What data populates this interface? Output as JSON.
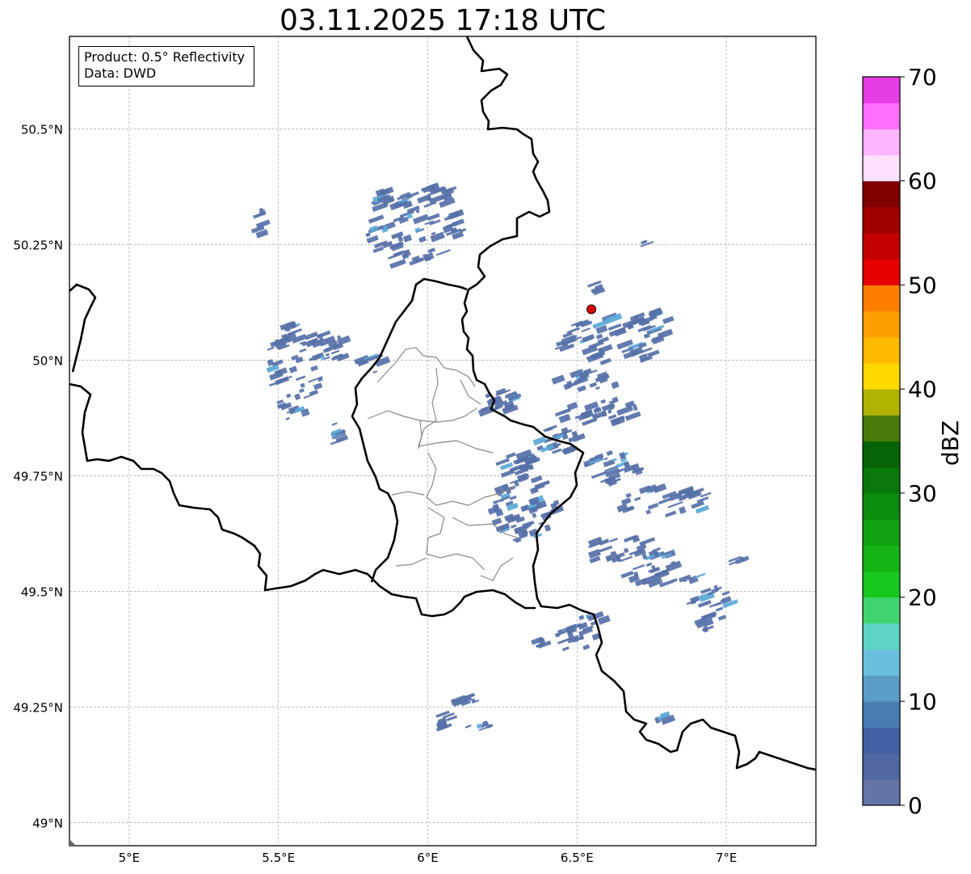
{
  "title": "03.11.2025 17:18 UTC",
  "info": {
    "product": "Product: 0.5° Reflectivity",
    "data": "Data: DWD"
  },
  "map_extent": {
    "lon": [
      4.8,
      7.3
    ],
    "lat": [
      48.95,
      50.7
    ]
  },
  "lat_ticks": [
    {
      "value": 50.5,
      "label": "50.5°N"
    },
    {
      "value": 50.25,
      "label": "50.25°N"
    },
    {
      "value": 50.0,
      "label": "50°N"
    },
    {
      "value": 49.75,
      "label": "49.75°N"
    },
    {
      "value": 49.5,
      "label": "49.5°N"
    },
    {
      "value": 49.25,
      "label": "49.25°N"
    },
    {
      "value": 49.0,
      "label": "49°N"
    }
  ],
  "lon_ticks": [
    {
      "value": 5.0,
      "label": "5°E"
    },
    {
      "value": 5.5,
      "label": "5.5°E"
    },
    {
      "value": 6.0,
      "label": "6°E"
    },
    {
      "value": 6.5,
      "label": "6.5°E"
    },
    {
      "value": 7.0,
      "label": "7°E"
    }
  ],
  "radar_site": {
    "lon": 6.548,
    "lat": 50.11,
    "color": "#e00000"
  },
  "colorbar": {
    "label": "dBZ",
    "range": [
      0,
      70
    ],
    "tick_values": [
      0,
      10,
      20,
      30,
      40,
      50,
      60,
      70
    ],
    "tick_labels": [
      "0",
      "10",
      "20",
      "30",
      "40",
      "50",
      "60",
      "70"
    ],
    "colors": [
      "#6473a6",
      "#5268a2",
      "#4260a4",
      "#4a7cb4",
      "#5a9ec8",
      "#68c0dc",
      "#5ed4c4",
      "#3fd46e",
      "#18c81e",
      "#14b414",
      "#10a010",
      "#0c8c0c",
      "#0a780a",
      "#066406",
      "#4a7a0a",
      "#b0b400",
      "#ffd800",
      "#ffba00",
      "#ff9e00",
      "#ff7e00",
      "#e60000",
      "#c40000",
      "#a20000",
      "#800000",
      "#ffe0ff",
      "#ffb4ff",
      "#ff6eff",
      "#e63ce6"
    ]
  },
  "echo_color": "#5670a8",
  "echo_highlight": "#5aa8d8"
}
